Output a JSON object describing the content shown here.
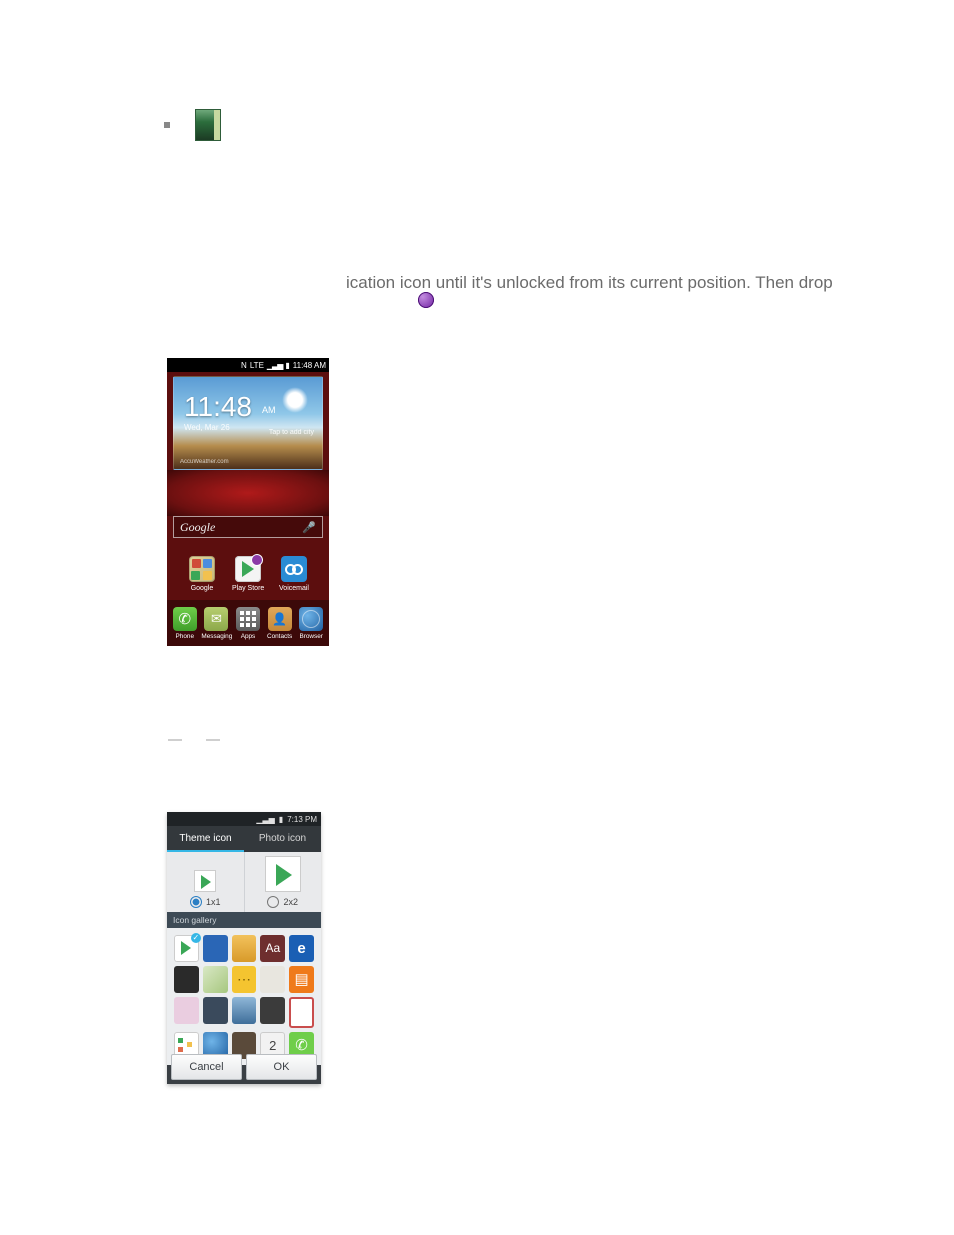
{
  "fragment": {
    "line1": "ication icon until it's unlocked from its current position. Then drop"
  },
  "phone1": {
    "status": {
      "carrier": "LTE",
      "time": "11:48 AM"
    },
    "clock": {
      "time": "11:48",
      "ampm": "AM",
      "date": "Wed, Mar 26",
      "city": "Tap to add city",
      "provider": "AccuWeather.com"
    },
    "search": {
      "logo": "Google"
    },
    "apps": {
      "google": "Google",
      "play": "Play Store",
      "voicemail": "Voicemail"
    },
    "dock": {
      "phone": "Phone",
      "messaging": "Messaging",
      "apps": "Apps",
      "contacts": "Contacts",
      "browser": "Browser"
    }
  },
  "phone2": {
    "status": {
      "time": "7:13 PM"
    },
    "tabs": {
      "theme": "Theme icon",
      "photo": "Photo icon"
    },
    "sizes": {
      "s1": "1x1",
      "s2": "2x2"
    },
    "gallery_header": "Icon gallery",
    "icons": {
      "g3": "Aa",
      "g4": "e",
      "g9": "▤",
      "g18": "2",
      "g19": "✆"
    },
    "buttons": {
      "cancel": "Cancel",
      "ok": "OK"
    }
  }
}
